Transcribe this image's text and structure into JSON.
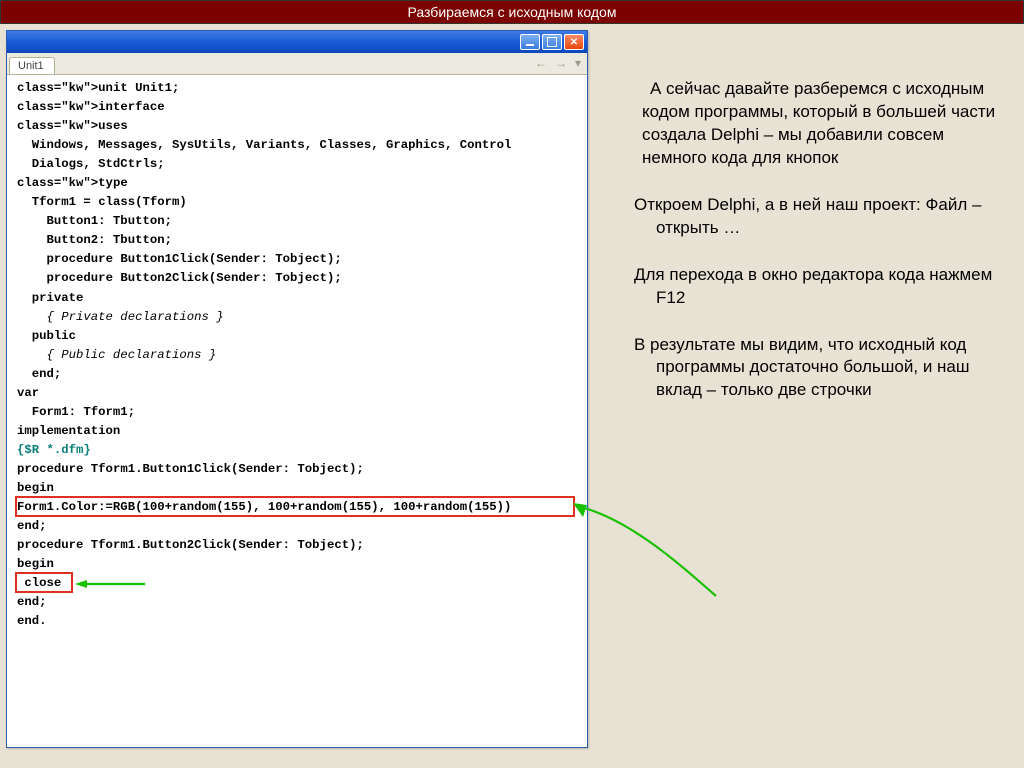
{
  "header": {
    "title": "Разбираемся с исходным кодом"
  },
  "ide": {
    "tab_label": "Unit1",
    "nav_back": "←",
    "nav_fwd": "→",
    "nav_menu": "▾",
    "code_lines": [
      "unit Unit1;",
      "",
      "interface",
      "",
      "uses",
      "  Windows, Messages, SysUtils, Variants, Classes, Graphics, Control",
      "  Dialogs, StdCtrls;",
      "",
      "type",
      "  Tform1 = class(Tform)",
      "    Button1: Tbutton;",
      "    Button2: Tbutton;",
      "    procedure Button1Click(Sender: Tobject);",
      "    procedure Button2Click(Sender: Tobject);",
      "  private",
      "    { Private declarations }",
      "  public",
      "    { Public declarations }",
      "  end;",
      "",
      "var",
      "  Form1: Tform1;",
      "",
      "implementation",
      "",
      "{$R *.dfm}",
      "",
      "procedure Tform1.Button1Click(Sender: Tobject);",
      "begin",
      "Form1.Color:=RGB(100+random(155), 100+random(155), 100+random(155))",
      "end;",
      "",
      "procedure Tform1.Button2Click(Sender: Tobject);",
      "begin",
      " close",
      "end;",
      "",
      "end."
    ]
  },
  "text": {
    "p1": " А сейчас давайте разберемся с исходным кодом программы, который в большей части создала Delphi – мы добавили совсем немного кода для кнопок",
    "p2": "Откроем  Delphi, а в ней наш проект: Файл – открыть …",
    "p3": "Для перехода в окно редактора кода нажмем F12",
    "p4": "В результате мы видим, что исходный код программы достаточно большой, и наш вклад – только две строчки"
  }
}
